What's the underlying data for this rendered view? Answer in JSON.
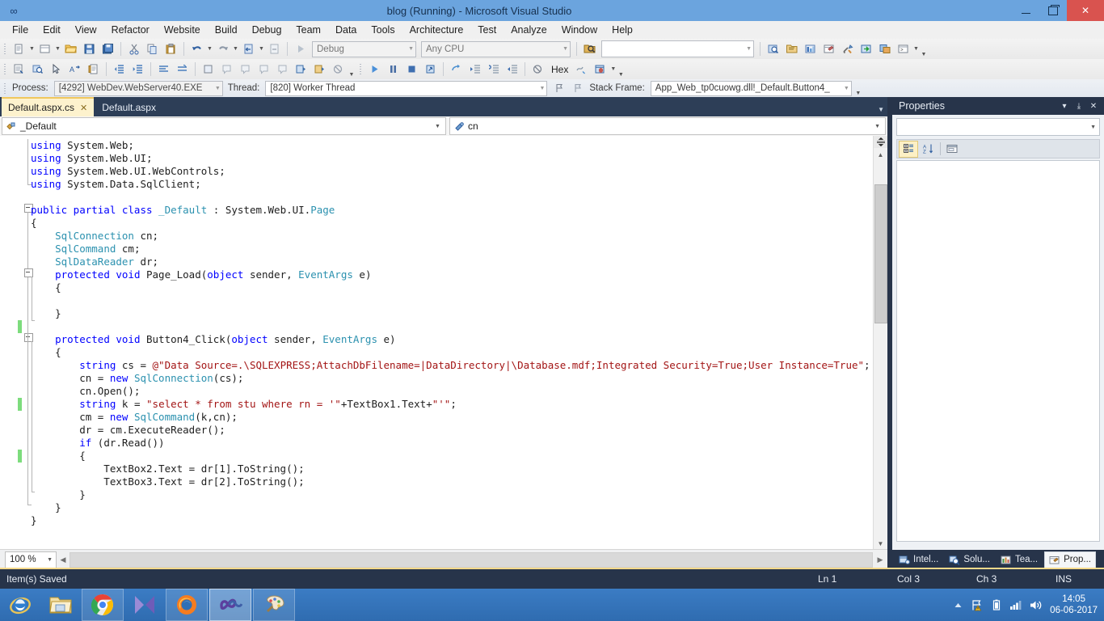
{
  "window": {
    "title": "blog (Running) - Microsoft Visual Studio",
    "minimize_label": "Minimize",
    "maximize_label": "Restore",
    "close_label": "Close"
  },
  "menubar": {
    "items": [
      {
        "label": "File"
      },
      {
        "label": "Edit"
      },
      {
        "label": "View"
      },
      {
        "label": "Refactor"
      },
      {
        "label": "Website"
      },
      {
        "label": "Build"
      },
      {
        "label": "Debug"
      },
      {
        "label": "Team"
      },
      {
        "label": "Data"
      },
      {
        "label": "Tools"
      },
      {
        "label": "Architecture"
      },
      {
        "label": "Test"
      },
      {
        "label": "Analyze"
      },
      {
        "label": "Window"
      },
      {
        "label": "Help"
      }
    ]
  },
  "toolbar_standard": {
    "config_combo": {
      "value": "Debug"
    },
    "platform_combo": {
      "value": "Any CPU"
    },
    "find_combo": {
      "value": "",
      "placeholder": ""
    },
    "start_label": "Start"
  },
  "toolbar_text": {
    "hex_label": "Hex"
  },
  "debug_toolbar": {
    "process_label": "Process:",
    "process_value": "[4292] WebDev.WebServer40.EXE",
    "thread_label": "Thread:",
    "thread_value": "[820] Worker Thread",
    "stackframe_label": "Stack Frame:",
    "stackframe_value": "App_Web_tp0cuowg.dll!_Default.Button4_"
  },
  "tabs": [
    {
      "label": "Default.aspx.cs",
      "active": true,
      "close": "✕"
    },
    {
      "label": "Default.aspx",
      "active": false,
      "close": ""
    }
  ],
  "navbar": {
    "type_value": "_Default",
    "member_value": "cn",
    "caret": "▾"
  },
  "editor": {
    "zoom": "100 %",
    "lines": [
      [
        {
          "t": "using ",
          "c": "kw"
        },
        {
          "t": "System.Web;",
          "c": "pl"
        }
      ],
      [
        {
          "t": "using ",
          "c": "kw"
        },
        {
          "t": "System.Web.UI;",
          "c": "pl"
        }
      ],
      [
        {
          "t": "using ",
          "c": "kw"
        },
        {
          "t": "System.Web.UI.WebControls;",
          "c": "pl"
        }
      ],
      [
        {
          "t": "using ",
          "c": "kw"
        },
        {
          "t": "System.Data.SqlClient;",
          "c": "pl"
        }
      ],
      [],
      [
        {
          "t": "public partial class ",
          "c": "kw"
        },
        {
          "t": "_Default",
          "c": "ty"
        },
        {
          "t": " : System.Web.UI.",
          "c": "pl"
        },
        {
          "t": "Page",
          "c": "ty"
        }
      ],
      [
        {
          "t": "{",
          "c": "pl"
        }
      ],
      [
        {
          "t": "    ",
          "c": "pl"
        },
        {
          "t": "SqlConnection",
          "c": "ty"
        },
        {
          "t": " cn;",
          "c": "pl"
        }
      ],
      [
        {
          "t": "    ",
          "c": "pl"
        },
        {
          "t": "SqlCommand",
          "c": "ty"
        },
        {
          "t": " cm;",
          "c": "pl"
        }
      ],
      [
        {
          "t": "    ",
          "c": "pl"
        },
        {
          "t": "SqlDataReader",
          "c": "ty"
        },
        {
          "t": " dr;",
          "c": "pl"
        }
      ],
      [
        {
          "t": "    ",
          "c": "pl"
        },
        {
          "t": "protected void ",
          "c": "kw"
        },
        {
          "t": "Page_Load(",
          "c": "pl"
        },
        {
          "t": "object",
          "c": "kw"
        },
        {
          "t": " sender, ",
          "c": "pl"
        },
        {
          "t": "EventArgs",
          "c": "ty"
        },
        {
          "t": " e)",
          "c": "pl"
        }
      ],
      [
        {
          "t": "    {",
          "c": "pl"
        }
      ],
      [],
      [
        {
          "t": "    }",
          "c": "pl"
        }
      ],
      [],
      [
        {
          "t": "    ",
          "c": "pl"
        },
        {
          "t": "protected void ",
          "c": "kw"
        },
        {
          "t": "Button4_Click(",
          "c": "pl"
        },
        {
          "t": "object",
          "c": "kw"
        },
        {
          "t": " sender, ",
          "c": "pl"
        },
        {
          "t": "EventArgs",
          "c": "ty"
        },
        {
          "t": " e)",
          "c": "pl"
        }
      ],
      [
        {
          "t": "    {",
          "c": "pl"
        }
      ],
      [
        {
          "t": "        ",
          "c": "pl"
        },
        {
          "t": "string",
          "c": "kw"
        },
        {
          "t": " cs = ",
          "c": "pl"
        },
        {
          "t": "@\"Data Source=.\\SQLEXPRESS;AttachDbFilename=|DataDirectory|\\Database.mdf;Integrated Security=True;User Instance=True\"",
          "c": "st"
        },
        {
          "t": ";",
          "c": "pl"
        }
      ],
      [
        {
          "t": "        cn = ",
          "c": "pl"
        },
        {
          "t": "new ",
          "c": "kw"
        },
        {
          "t": "SqlConnection",
          "c": "ty"
        },
        {
          "t": "(cs);",
          "c": "pl"
        }
      ],
      [
        {
          "t": "        cn.Open();",
          "c": "pl"
        }
      ],
      [
        {
          "t": "        ",
          "c": "pl"
        },
        {
          "t": "string",
          "c": "kw"
        },
        {
          "t": " k = ",
          "c": "pl"
        },
        {
          "t": "\"select * from stu where rn = '\"",
          "c": "st"
        },
        {
          "t": "+TextBox1.Text+",
          "c": "pl"
        },
        {
          "t": "\"'\"",
          "c": "st"
        },
        {
          "t": ";",
          "c": "pl"
        }
      ],
      [
        {
          "t": "        cm = ",
          "c": "pl"
        },
        {
          "t": "new ",
          "c": "kw"
        },
        {
          "t": "SqlCommand",
          "c": "ty"
        },
        {
          "t": "(k,cn);",
          "c": "pl"
        }
      ],
      [
        {
          "t": "        dr = cm.ExecuteReader();",
          "c": "pl"
        }
      ],
      [
        {
          "t": "        ",
          "c": "pl"
        },
        {
          "t": "if ",
          "c": "kw"
        },
        {
          "t": "(dr.Read())",
          "c": "pl"
        }
      ],
      [
        {
          "t": "        {",
          "c": "pl"
        }
      ],
      [
        {
          "t": "            TextBox2.Text = dr[1].ToString();",
          "c": "pl"
        }
      ],
      [
        {
          "t": "            TextBox3.Text = dr[2].ToString();",
          "c": "pl"
        }
      ],
      [
        {
          "t": "        }",
          "c": "pl"
        }
      ],
      [
        {
          "t": "    }",
          "c": "pl"
        }
      ],
      [
        {
          "t": "}",
          "c": "pl"
        }
      ]
    ]
  },
  "properties": {
    "title": "Properties",
    "dropdown_caret": "▾",
    "pin_glyph": "⤓",
    "close_glyph": "✕",
    "object_value": "",
    "sort_categorized": "Categorized",
    "sort_alphabetical": "Alphabetical",
    "property_pages": "Property Pages"
  },
  "pane_tabs": [
    {
      "label": "Intel...",
      "active": false
    },
    {
      "label": "Solu...",
      "active": false
    },
    {
      "label": "Tea...",
      "active": false
    },
    {
      "label": "Prop...",
      "active": true
    }
  ],
  "statusbar": {
    "message": "Item(s) Saved",
    "line": "Ln 1",
    "column": "Col 3",
    "character": "Ch 3",
    "insert_mode": "INS"
  },
  "taskbar": {
    "items": [
      {
        "name": "internet-explorer",
        "label": "Internet Explorer",
        "boxed": false,
        "active": false
      },
      {
        "name": "file-explorer",
        "label": "File Explorer",
        "boxed": false,
        "active": false
      },
      {
        "name": "google-chrome",
        "label": "Google Chrome",
        "boxed": true,
        "active": false
      },
      {
        "name": "media-player",
        "label": "Media Player",
        "boxed": false,
        "active": false
      },
      {
        "name": "firefox",
        "label": "Mozilla Firefox",
        "boxed": true,
        "active": false
      },
      {
        "name": "visual-studio",
        "label": "Visual Studio",
        "boxed": true,
        "active": true
      },
      {
        "name": "paint",
        "label": "Paint",
        "boxed": true,
        "active": false
      }
    ],
    "tray": {
      "show_hidden": "▲",
      "network_label": "Network",
      "battery_label": "Battery",
      "signal_label": "Signal",
      "volume_label": "Volume"
    },
    "clock": {
      "time": "14:05",
      "date": "06-06-2017"
    }
  },
  "colors": {
    "title_bar": "#6ba4de",
    "accent_dark": "#27344a",
    "tab_active": "#fdf2cd",
    "taskbar": "#3b7cc4",
    "change_marker": "#7ddc7d",
    "keyword": "#0000ff",
    "type": "#2b91af",
    "string": "#a31515"
  }
}
